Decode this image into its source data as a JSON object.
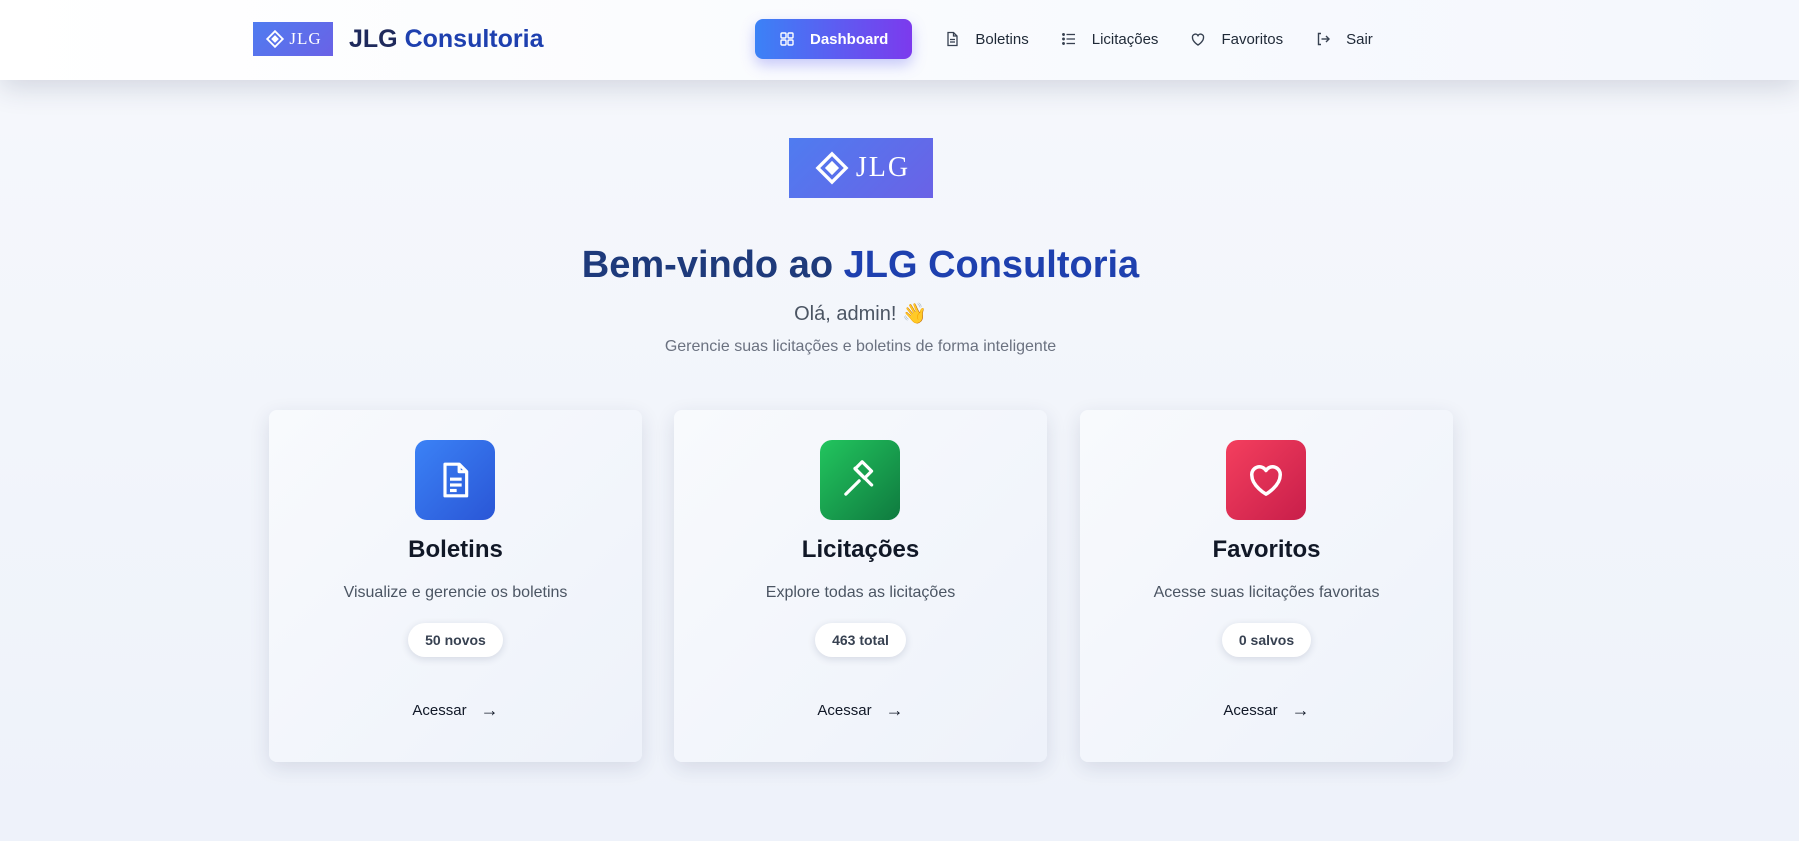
{
  "header": {
    "logo_text": "JLG",
    "brand_first": "JLG ",
    "brand_accent": "Consultoria",
    "nav": [
      {
        "label": "Dashboard",
        "icon": "grid-icon",
        "active": true
      },
      {
        "label": "Boletins",
        "icon": "file-icon",
        "active": false
      },
      {
        "label": "Licitações",
        "icon": "list-icon",
        "active": false
      },
      {
        "label": "Favoritos",
        "icon": "heart-icon",
        "active": false
      },
      {
        "label": "Sair",
        "icon": "logout-icon",
        "active": false
      }
    ]
  },
  "hero": {
    "logo_text": "JLG",
    "title_first": "Bem-vindo ao ",
    "title_accent": "JLG Consultoria",
    "greeting": "Olá, admin! 👋",
    "subtitle": "Gerencie suas licitações e boletins de forma inteligente"
  },
  "cards": [
    {
      "title": "Boletins",
      "description": "Visualize e gerencie os boletins",
      "badge": "50 novos",
      "action": "Acessar",
      "arrow": "→",
      "icon": "document-icon",
      "color": "#2a56d6"
    },
    {
      "title": "Licitações",
      "description": "Explore todas as licitações",
      "badge": "463 total",
      "action": "Acessar",
      "arrow": "→",
      "icon": "gavel-icon",
      "color": "#0f7a3f"
    },
    {
      "title": "Favoritos",
      "description": "Acesse suas licitações favoritas",
      "badge": "0 salvos",
      "action": "Acessar",
      "arrow": "→",
      "icon": "heart-icon",
      "color": "#c81e4a"
    }
  ],
  "colors": {
    "brand": "#1e40af",
    "nav_active_start": "#3b82f6",
    "nav_active_end": "#7c3aed"
  }
}
